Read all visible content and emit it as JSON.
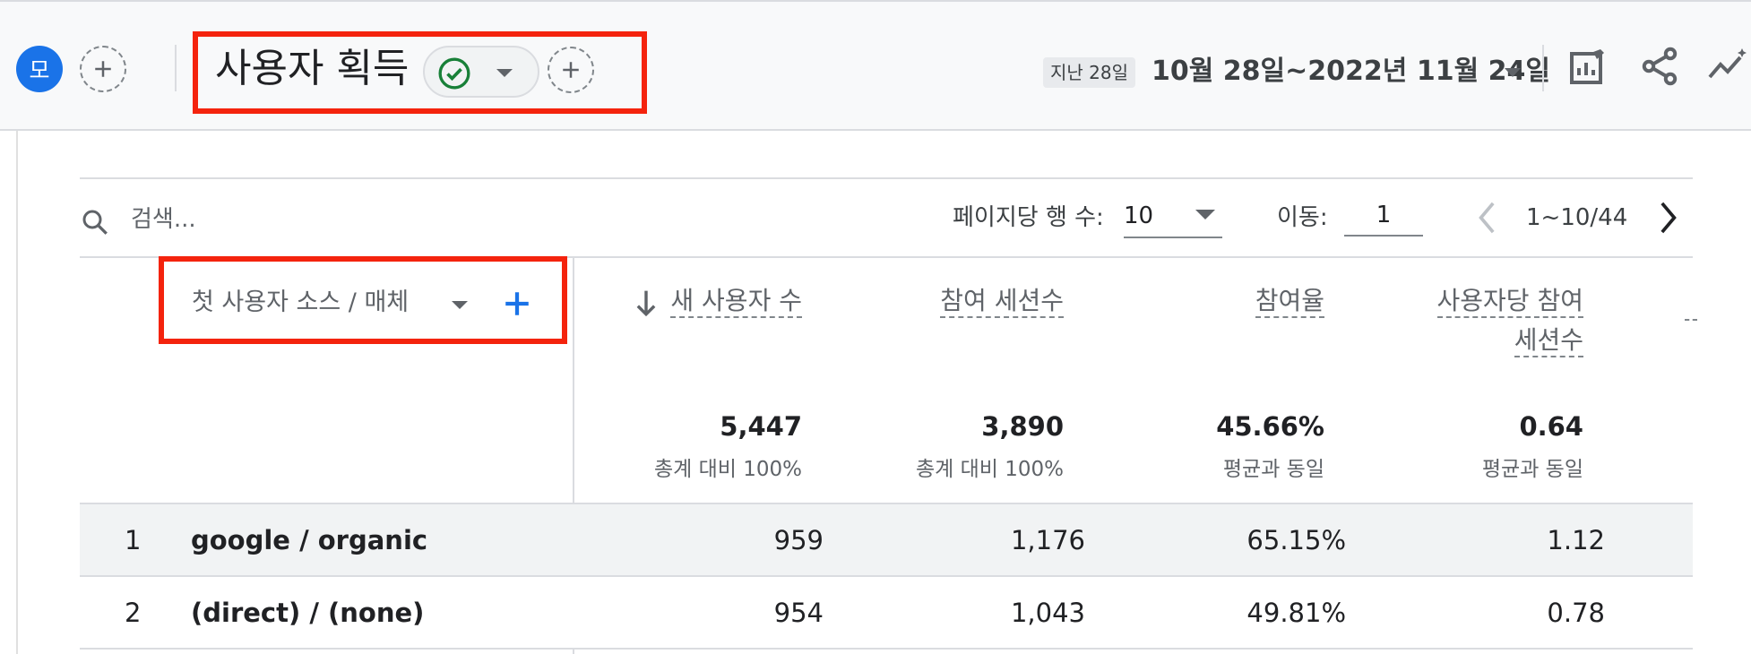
{
  "header": {
    "avatar_letter": "모",
    "report_title": "사용자 획득",
    "date_preset": "지난 28일",
    "date_range": "10월 28일~2022년 11월 24일",
    "colors": {
      "accent": "#1a73e8",
      "success": "#188038",
      "highlight_box": "#f4230d"
    },
    "icons": [
      "plus-icon",
      "check-circle-icon",
      "chevron-down-icon",
      "edit-report-icon",
      "share-icon",
      "insights-icon"
    ]
  },
  "toolbar": {
    "search_placeholder": "검색...",
    "rows_per_page_label": "페이지당 행 수:",
    "rows_per_page_value": "10",
    "goto_label": "이동:",
    "goto_value": "1",
    "page_range": "1~10/44"
  },
  "table": {
    "dimension_header": "첫 사용자 소스 / 매체",
    "columns": [
      {
        "label": "새 사용자 수",
        "sorted": "desc",
        "total": "5,447",
        "total_note": "총계 대비 100%"
      },
      {
        "label": "참여 세션수",
        "total": "3,890",
        "total_note": "총계 대비 100%"
      },
      {
        "label": "참여율",
        "total": "45.66%",
        "total_note": "평균과 동일"
      },
      {
        "label_line1": "사용자당 참여",
        "label_line2": "세션수",
        "total": "0.64",
        "total_note": "평균과 동일"
      }
    ],
    "rows": [
      {
        "index": "1",
        "dimension": "google / organic",
        "values": [
          "959",
          "1,176",
          "65.15%",
          "1.12"
        ]
      },
      {
        "index": "2",
        "dimension": "(direct) / (none)",
        "values": [
          "954",
          "1,043",
          "49.81%",
          "0.78"
        ]
      }
    ]
  }
}
